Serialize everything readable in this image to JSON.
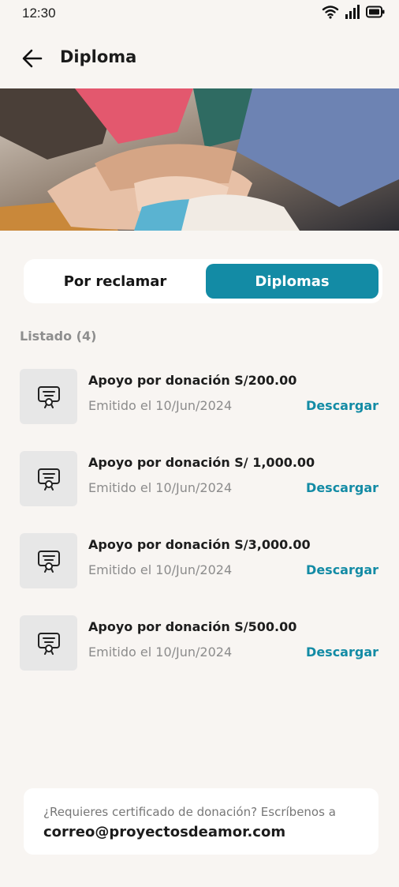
{
  "status": {
    "time": "12:30"
  },
  "header": {
    "title": "Diploma"
  },
  "tabs": [
    {
      "label": "Por reclamar",
      "active": false
    },
    {
      "label": "Diplomas",
      "active": true
    }
  ],
  "list": {
    "title": "Listado (4)",
    "items": [
      {
        "title": "Apoyo por donación S/200.00",
        "date": "Emitido el 10/Jun/2024",
        "action": "Descargar",
        "icon": "certificate-icon"
      },
      {
        "title": "Apoyo por donación S/ 1,000.00",
        "date": "Emitido el 10/Jun/2024",
        "action": "Descargar",
        "icon": "certificate-icon"
      },
      {
        "title": "Apoyo por donación S/3,000.00",
        "date": "Emitido el 10/Jun/2024",
        "action": "Descargar",
        "icon": "certificate-icon"
      },
      {
        "title": "Apoyo por donación S/500.00",
        "date": "Emitido el 10/Jun/2024",
        "action": "Descargar",
        "icon": "certificate-icon"
      }
    ]
  },
  "footer": {
    "question": "¿Requieres certificado de donación? Escríbenos a",
    "email": "correo@proyectosdeamor.com"
  },
  "colors": {
    "accent": "#138ba5",
    "background": "#f8f5f2"
  }
}
